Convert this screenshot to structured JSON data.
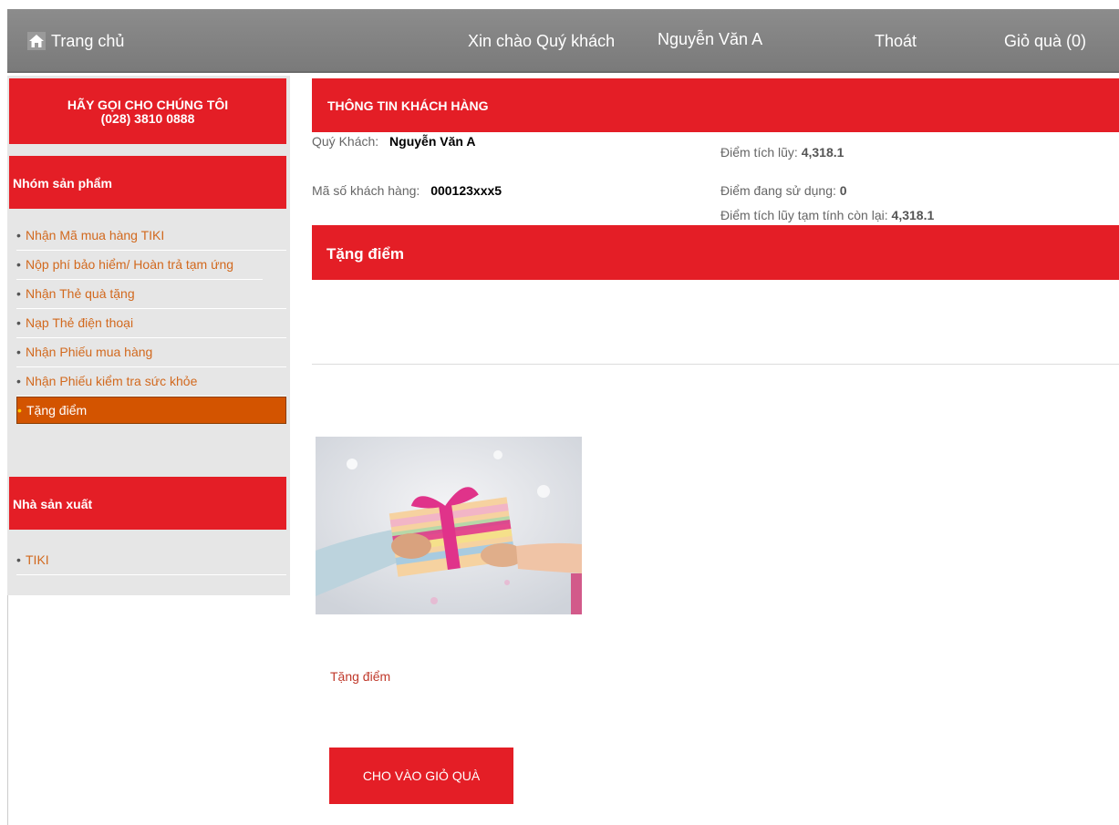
{
  "topbar": {
    "home_label": "Trang chủ",
    "home_icon": "home-icon",
    "greeting": "Xin chào Quý khách",
    "username": "Nguyễn Văn A",
    "logout": "Thoát",
    "cart": "Giỏ quà (0)"
  },
  "sidebar": {
    "hotline_title": "HÃY GỌI CHO CHÚNG TÔI",
    "hotline_number": "(028) 3810 0888",
    "group1_title": "Nhóm sản phẩm",
    "group1_items": [
      "Nhận Mã mua hàng TIKI",
      "Nộp phí bảo hiểm/ Hoàn trả tạm ứng",
      "Nhận Thẻ quà tặng",
      "Nạp Thẻ điện thoại",
      "Nhận Phiếu mua hàng",
      "Nhận Phiếu kiểm tra sức khỏe",
      "Tặng điểm"
    ],
    "group1_active": "Tặng điểm",
    "group2_title": "Nhà sản xuất",
    "group2_items": [
      "TIKI"
    ]
  },
  "customer": {
    "section_title": "THÔNG TIN KHÁCH HÀNG",
    "name_label": "Quý Khách:",
    "name_value": "Nguyễn Văn A",
    "id_label": "Mã số khách hàng:",
    "id_value": "000123xxx5",
    "points_label": "Điểm tích lũy:",
    "points_value": "4,318.1",
    "used_label": "Điểm đang sử dụng:",
    "used_value": "0",
    "remaining_label": "Điểm tích lũy tạm tính còn lại:",
    "remaining_value": "4,318.1"
  },
  "product": {
    "section_title": "Tặng điểm",
    "name": "Tặng điểm",
    "add_button": "CHO VÀO GIỎ QUÀ"
  },
  "colors": {
    "accent_red": "#e41e26",
    "active_orange": "#d35400",
    "topbar_gray": "#8c8c8c"
  }
}
